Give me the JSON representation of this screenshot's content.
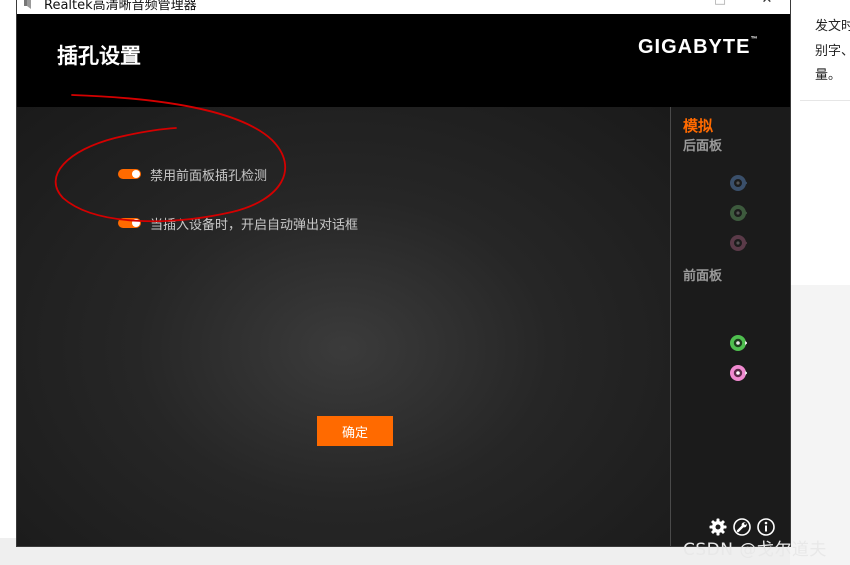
{
  "background_page": {
    "lines": [
      "发文时",
      "别字、",
      "量。"
    ],
    "watermark": "CSDN @戈尔道夫"
  },
  "window": {
    "title": "Realtek高清晰音频管理器",
    "minimize_glyph": "—",
    "maximize_glyph": "□",
    "close_glyph": "✕"
  },
  "header": {
    "title": "插孔设置",
    "brand": "GIGABYTE",
    "brand_mark": "™"
  },
  "options": [
    {
      "label": "禁用前面板插孔检测",
      "enabled": true
    },
    {
      "label": "当插入设备时，开启自动弹出对话框",
      "enabled": true
    }
  ],
  "ok_button": {
    "label": "确定"
  },
  "side_panel": {
    "mode": "模拟",
    "rear_panel": "后面板",
    "front_panel": "前面板",
    "rear_jacks": [
      {
        "icon": "audio-jack-blue-icon",
        "color": "#3a4f6a",
        "active": false
      },
      {
        "icon": "audio-jack-green-icon",
        "color": "#3d5a3d",
        "active": false
      },
      {
        "icon": "audio-jack-pink-icon",
        "color": "#5a3a48",
        "active": false
      }
    ],
    "front_jacks": [
      {
        "icon": "audio-jack-green-icon",
        "color": "#4fbf4f",
        "active": true
      },
      {
        "icon": "audio-jack-pink-icon",
        "color": "#f08ad0",
        "active": true
      }
    ]
  },
  "bottom_icons": [
    "gear-icon",
    "wrench-icon",
    "info-icon"
  ],
  "colors": {
    "accent": "#ff6a00",
    "annotation": "#d40000"
  }
}
